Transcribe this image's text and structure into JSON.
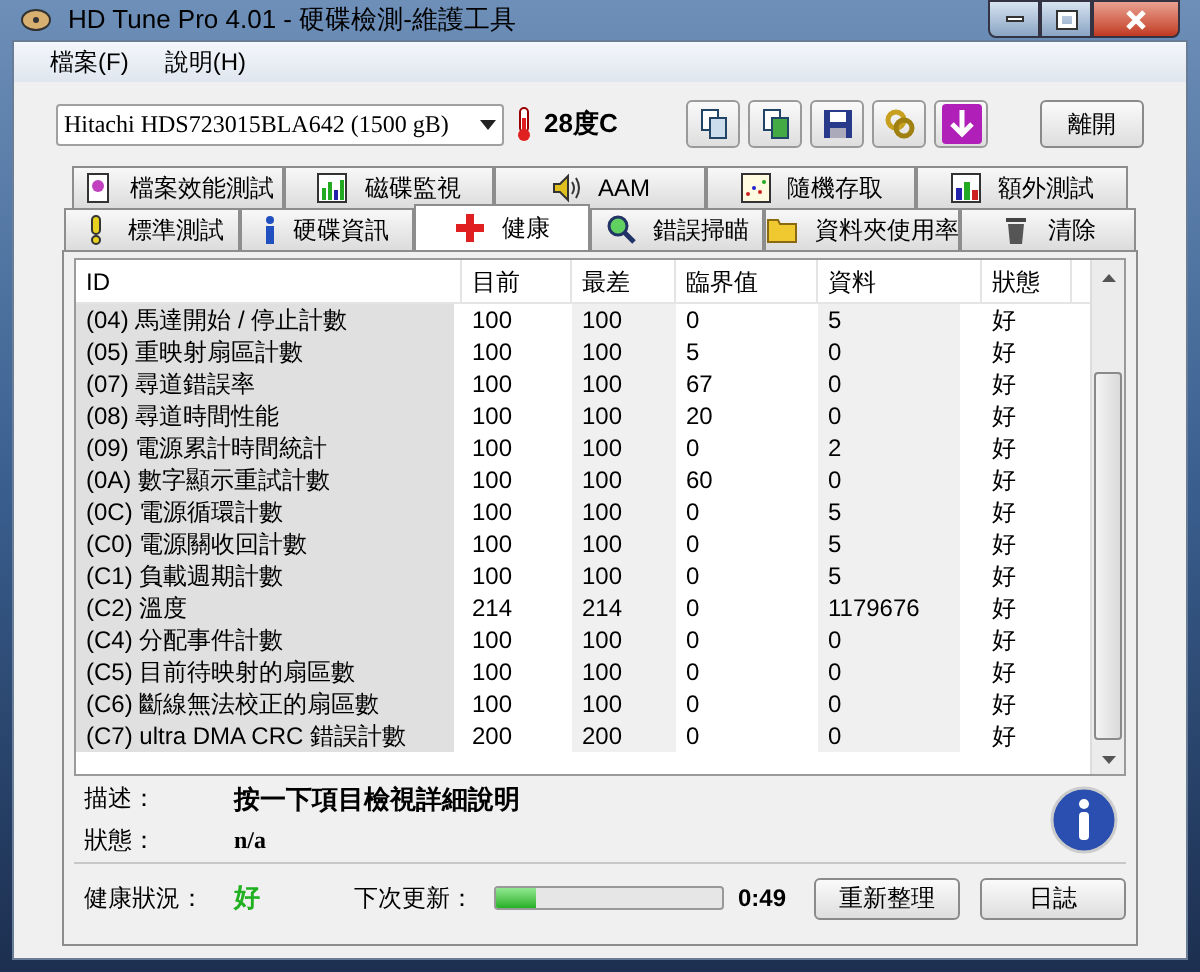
{
  "window": {
    "title": "HD Tune Pro 4.01 - 硬碟檢測-維護工具"
  },
  "menu": [
    "檔案(F)",
    "說明(H)"
  ],
  "drive": {
    "value": "Hitachi HDS723015BLA642 (1500 gB)"
  },
  "temperature": "28度C",
  "exit_button": "離開",
  "tabs_top": [
    {
      "label": "檔案效能測試",
      "selected": false
    },
    {
      "label": "磁碟監視",
      "selected": false
    },
    {
      "label": "AAM",
      "selected": false
    },
    {
      "label": "隨機存取",
      "selected": false
    },
    {
      "label": "額外測試",
      "selected": false
    }
  ],
  "tabs_bottom": [
    {
      "label": "標準測試",
      "selected": false
    },
    {
      "label": "硬碟資訊",
      "selected": false
    },
    {
      "label": "健康",
      "selected": true
    },
    {
      "label": "錯誤掃瞄",
      "selected": false
    },
    {
      "label": "資料夾使用率",
      "selected": false
    },
    {
      "label": "清除",
      "selected": false
    }
  ],
  "table": {
    "columns": [
      "ID",
      "目前",
      "最差",
      "臨界值",
      "資料",
      "狀態"
    ],
    "rows": [
      [
        "(04) 馬達開始 / 停止計數",
        "100",
        "100",
        "0",
        "5",
        "好"
      ],
      [
        "(05) 重映射扇區計數",
        "100",
        "100",
        "5",
        "0",
        "好"
      ],
      [
        "(07) 尋道錯誤率",
        "100",
        "100",
        "67",
        "0",
        "好"
      ],
      [
        "(08) 尋道時間性能",
        "100",
        "100",
        "20",
        "0",
        "好"
      ],
      [
        "(09) 電源累計時間統計",
        "100",
        "100",
        "0",
        "2",
        "好"
      ],
      [
        "(0A) 數字顯示重試計數",
        "100",
        "100",
        "60",
        "0",
        "好"
      ],
      [
        "(0C) 電源循環計數",
        "100",
        "100",
        "0",
        "5",
        "好"
      ],
      [
        "(C0) 電源關收回計數",
        "100",
        "100",
        "0",
        "5",
        "好"
      ],
      [
        "(C1) 負載週期計數",
        "100",
        "100",
        "0",
        "5",
        "好"
      ],
      [
        "(C2) 溫度",
        "214",
        "214",
        "0",
        "1179676",
        "好"
      ],
      [
        "(C4) 分配事件計數",
        "100",
        "100",
        "0",
        "0",
        "好"
      ],
      [
        "(C5) 目前待映射的扇區數",
        "100",
        "100",
        "0",
        "0",
        "好"
      ],
      [
        "(C6) 斷線無法校正的扇區數",
        "100",
        "100",
        "0",
        "0",
        "好"
      ],
      [
        "(C7) ultra DMA CRC 錯誤計數",
        "200",
        "200",
        "0",
        "0",
        "好"
      ]
    ]
  },
  "description": {
    "label": "描述：",
    "value": "按一下項目檢視詳細說明"
  },
  "status": {
    "label": "狀態：",
    "value": "n/a"
  },
  "health": {
    "label": "健康狀況：",
    "value": "好"
  },
  "next_update": {
    "label": "下次更新：",
    "level": 0.18,
    "time": "0:49"
  },
  "buttons": [
    "重新整理",
    "日誌"
  ]
}
